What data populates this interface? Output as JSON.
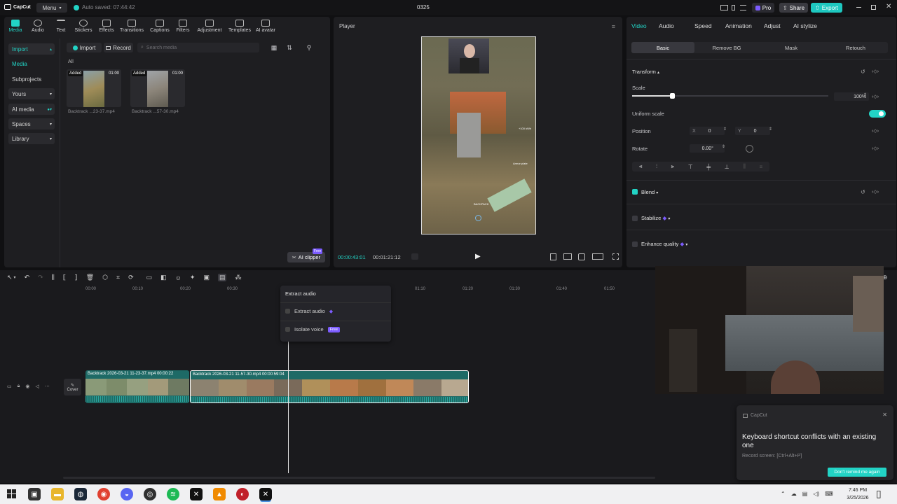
{
  "app": {
    "logo": "CapCut",
    "menu": "Menu",
    "autosave": "Auto saved: 07:44:42",
    "project_title": "0325",
    "pro": "Pro",
    "share": "Share",
    "export": "Export"
  },
  "toolbar_tabs": [
    {
      "label": "Media",
      "icon": "media-icon"
    },
    {
      "label": "Audio",
      "icon": "audio-icon"
    },
    {
      "label": "Text",
      "icon": "text-icon"
    },
    {
      "label": "Stickers",
      "icon": "stickers-icon"
    },
    {
      "label": "Effects",
      "icon": "effects-icon"
    },
    {
      "label": "Transitions",
      "icon": "transitions-icon"
    },
    {
      "label": "Captions",
      "icon": "captions-icon"
    },
    {
      "label": "Filters",
      "icon": "filters-icon"
    },
    {
      "label": "Adjustment",
      "icon": "adjustment-icon"
    },
    {
      "label": "Templates",
      "icon": "templates-icon"
    },
    {
      "label": "AI avatar",
      "icon": "ai-avatar-icon"
    }
  ],
  "sidebar": {
    "items": [
      "Import",
      "Media",
      "Subprojects",
      "Yours",
      "AI media",
      "Spaces",
      "Library"
    ]
  },
  "media": {
    "import": "Import",
    "record": "Record",
    "search_placeholder": "Search media",
    "filter_label": "All",
    "items": [
      {
        "badge": "Added",
        "duration": "01:00",
        "name": "Backtrack ...23-37.mp4"
      },
      {
        "badge": "Added",
        "duration": "01:00",
        "name": "Backtrack ...57-30.mp4"
      }
    ],
    "ai_clipper": "AI clipper",
    "free": "Free"
  },
  "player": {
    "title": "Player",
    "current_time": "00:00:43:01",
    "total_time": "00:01:21:12",
    "overlay_labels": [
      "+100 kWh",
      "Armor plate",
      "BACKPACK"
    ]
  },
  "inspector": {
    "tabs": [
      "Video",
      "Audio",
      "Speed",
      "Animation",
      "Adjust",
      "AI stylize"
    ],
    "subtabs": [
      "Basic",
      "Remove BG",
      "Mask",
      "Retouch"
    ],
    "transform": "Transform",
    "scale_label": "Scale",
    "scale_value": "100%",
    "uniform_scale": "Uniform scale",
    "position_label": "Position",
    "pos_x_label": "X",
    "pos_x": "0",
    "pos_y_label": "Y",
    "pos_y": "0",
    "rotate_label": "Rotate",
    "rotate_value": "0.00°",
    "blend": "Blend",
    "stabilize": "Stabilize",
    "enhance": "Enhance quality"
  },
  "timeline": {
    "ticks": [
      "00:00",
      "00:10",
      "00:20",
      "00:30",
      "01:10",
      "01:20",
      "01:30",
      "01:40",
      "01:50"
    ],
    "cover": "Cover",
    "clips": [
      {
        "name": "Backtrack 2026-03-21 11-23-37.mp4",
        "duration": "00:00:22"
      },
      {
        "name": "Backtrack 2026-03-21 11-57-30.mp4",
        "duration": "00:00:59:04"
      }
    ]
  },
  "extract_menu": {
    "title": "Extract audio",
    "items": [
      {
        "label": "Extract audio"
      },
      {
        "label": "Isolate voice",
        "badge": "Free"
      }
    ]
  },
  "notification": {
    "app": "CapCut",
    "title": "Keyboard shortcut conflicts with an existing one",
    "detail": "Record screen: [Ctrl+Alt+P]",
    "button": "Don't remind me again"
  },
  "taskbar": {
    "time": "7:46 PM",
    "date": "3/25/2026"
  },
  "colors": {
    "accent": "#22d3c5",
    "export": "#1ec8c0",
    "pro_badge": "#7c5cff"
  }
}
